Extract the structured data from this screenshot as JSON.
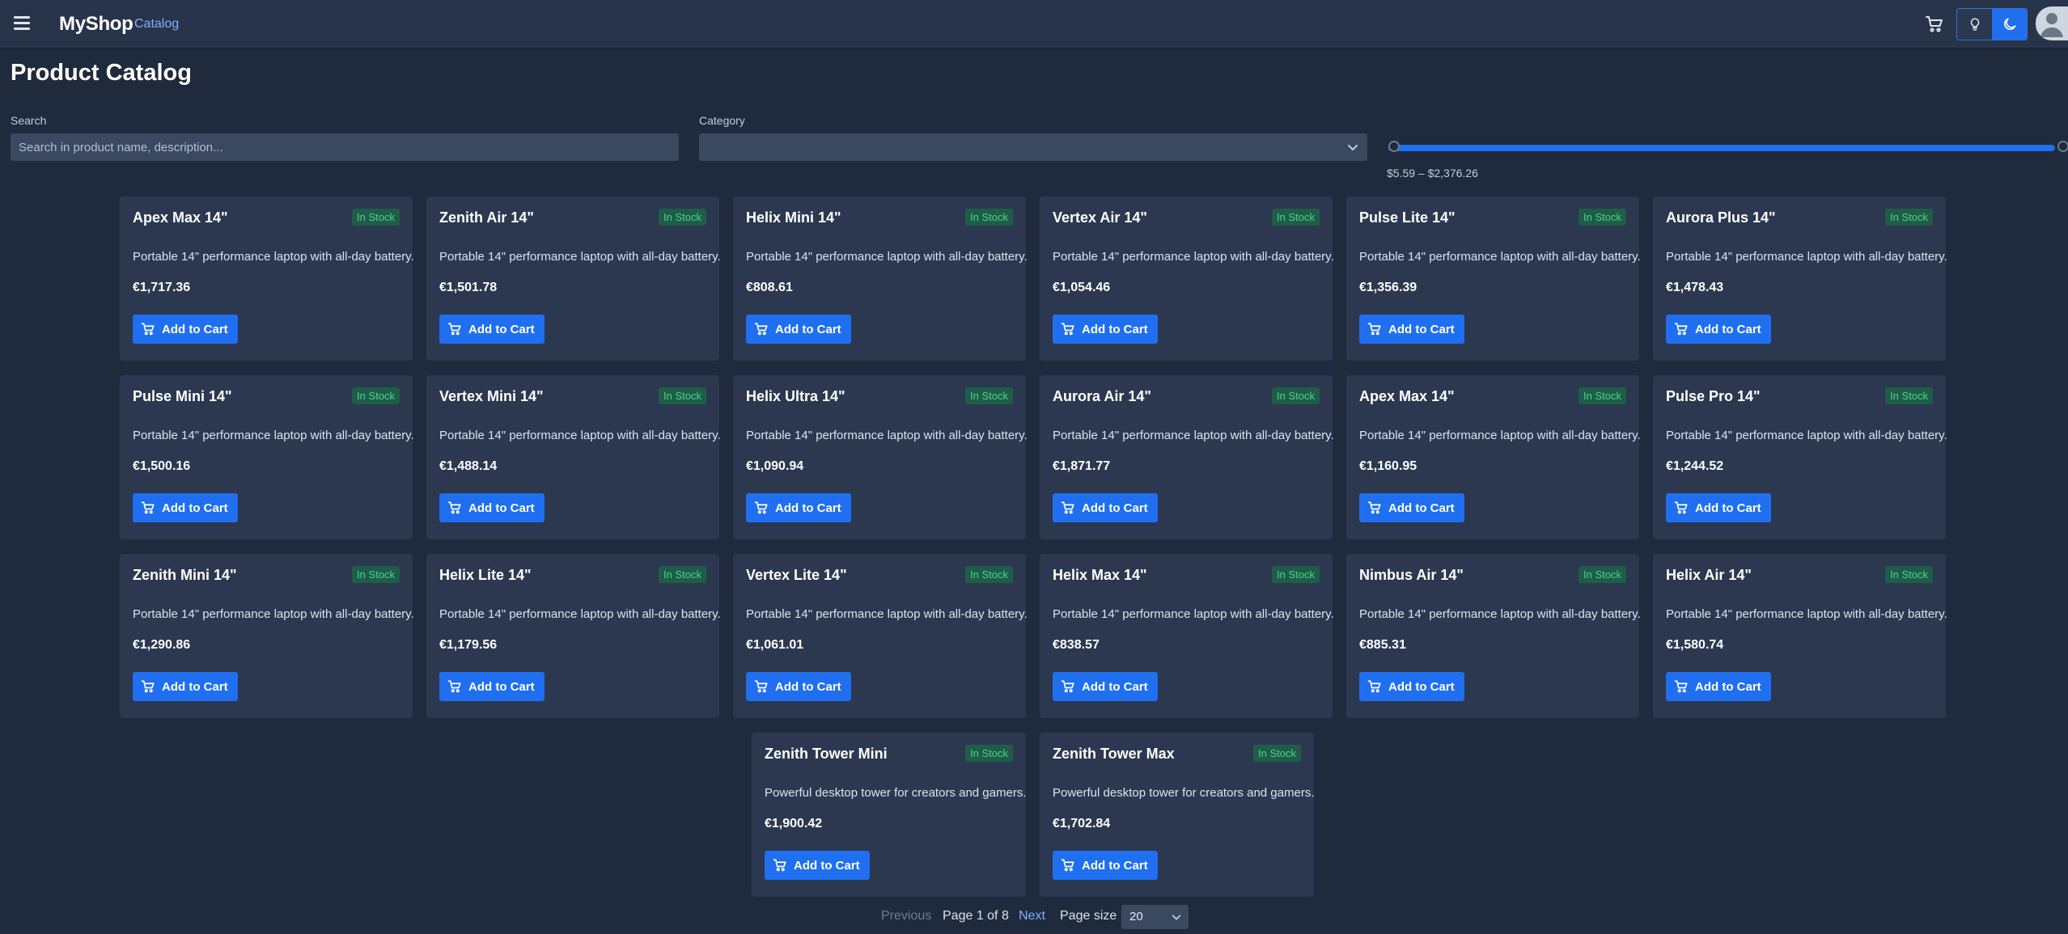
{
  "header": {
    "brand": "MyShop",
    "breadcrumb": "Catalog"
  },
  "page": {
    "title": "Product Catalog"
  },
  "filters": {
    "search_label": "Search",
    "search_placeholder": "Search in product name, description...",
    "search_value": "",
    "category_label": "Category",
    "category_value": "",
    "price_range_text": "$5.59 – $2,376.26",
    "price_min": 5.59,
    "price_max": 2376.26
  },
  "products": [
    {
      "name": "Apex Max 14\"",
      "stock": "In Stock",
      "description": "Portable 14\" performance laptop with all-day battery.",
      "price": "€1,717.36",
      "button": "Add to Cart"
    },
    {
      "name": "Zenith Air 14\"",
      "stock": "In Stock",
      "description": "Portable 14\" performance laptop with all-day battery.",
      "price": "€1,501.78",
      "button": "Add to Cart"
    },
    {
      "name": "Helix Mini 14\"",
      "stock": "In Stock",
      "description": "Portable 14\" performance laptop with all-day battery.",
      "price": "€808.61",
      "button": "Add to Cart"
    },
    {
      "name": "Vertex Air 14\"",
      "stock": "In Stock",
      "description": "Portable 14\" performance laptop with all-day battery.",
      "price": "€1,054.46",
      "button": "Add to Cart"
    },
    {
      "name": "Pulse Lite 14\"",
      "stock": "In Stock",
      "description": "Portable 14\" performance laptop with all-day battery.",
      "price": "€1,356.39",
      "button": "Add to Cart"
    },
    {
      "name": "Aurora Plus 14\"",
      "stock": "In Stock",
      "description": "Portable 14\" performance laptop with all-day battery.",
      "price": "€1,478.43",
      "button": "Add to Cart"
    },
    {
      "name": "Pulse Mini 14\"",
      "stock": "In Stock",
      "description": "Portable 14\" performance laptop with all-day battery.",
      "price": "€1,500.16",
      "button": "Add to Cart"
    },
    {
      "name": "Vertex Mini 14\"",
      "stock": "In Stock",
      "description": "Portable 14\" performance laptop with all-day battery.",
      "price": "€1,488.14",
      "button": "Add to Cart"
    },
    {
      "name": "Helix Ultra 14\"",
      "stock": "In Stock",
      "description": "Portable 14\" performance laptop with all-day battery.",
      "price": "€1,090.94",
      "button": "Add to Cart"
    },
    {
      "name": "Aurora Air 14\"",
      "stock": "In Stock",
      "description": "Portable 14\" performance laptop with all-day battery.",
      "price": "€1,871.77",
      "button": "Add to Cart"
    },
    {
      "name": "Apex Max 14\"",
      "stock": "In Stock",
      "description": "Portable 14\" performance laptop with all-day battery.",
      "price": "€1,160.95",
      "button": "Add to Cart"
    },
    {
      "name": "Pulse Pro 14\"",
      "stock": "In Stock",
      "description": "Portable 14\" performance laptop with all-day battery.",
      "price": "€1,244.52",
      "button": "Add to Cart"
    },
    {
      "name": "Zenith Mini 14\"",
      "stock": "In Stock",
      "description": "Portable 14\" performance laptop with all-day battery.",
      "price": "€1,290.86",
      "button": "Add to Cart"
    },
    {
      "name": "Helix Lite 14\"",
      "stock": "In Stock",
      "description": "Portable 14\" performance laptop with all-day battery.",
      "price": "€1,179.56",
      "button": "Add to Cart"
    },
    {
      "name": "Vertex Lite 14\"",
      "stock": "In Stock",
      "description": "Portable 14\" performance laptop with all-day battery.",
      "price": "€1,061.01",
      "button": "Add to Cart"
    },
    {
      "name": "Helix Max 14\"",
      "stock": "In Stock",
      "description": "Portable 14\" performance laptop with all-day battery.",
      "price": "€838.57",
      "button": "Add to Cart"
    },
    {
      "name": "Nimbus Air 14\"",
      "stock": "In Stock",
      "description": "Portable 14\" performance laptop with all-day battery.",
      "price": "€885.31",
      "button": "Add to Cart"
    },
    {
      "name": "Helix Air 14\"",
      "stock": "In Stock",
      "description": "Portable 14\" performance laptop with all-day battery.",
      "price": "€1,580.74",
      "button": "Add to Cart"
    },
    {
      "name": "Zenith Tower Mini",
      "stock": "In Stock",
      "description": "Powerful desktop tower for creators and gamers.",
      "price": "€1,900.42",
      "button": "Add to Cart"
    },
    {
      "name": "Zenith Tower Max",
      "stock": "In Stock",
      "description": "Powerful desktop tower for creators and gamers.",
      "price": "€1,702.84",
      "button": "Add to Cart"
    }
  ],
  "pagination": {
    "previous": "Previous",
    "info": "Page 1 of 8",
    "next": "Next",
    "page_size_label": "Page size",
    "page_size": "20"
  },
  "colors": {
    "background": "#1f2a3c",
    "header": "#283449",
    "card": "#2b3850",
    "accent": "#1f6ff0",
    "in_stock_text": "#4ad38a",
    "in_stock_bg": "#1f5d48"
  },
  "icons": {
    "menu": "hamburger-icon",
    "cart": "cart-icon",
    "light_theme": "lightbulb-icon",
    "dark_theme": "moon-icon",
    "user": "user-icon",
    "dropdown": "chevron-down-icon"
  }
}
